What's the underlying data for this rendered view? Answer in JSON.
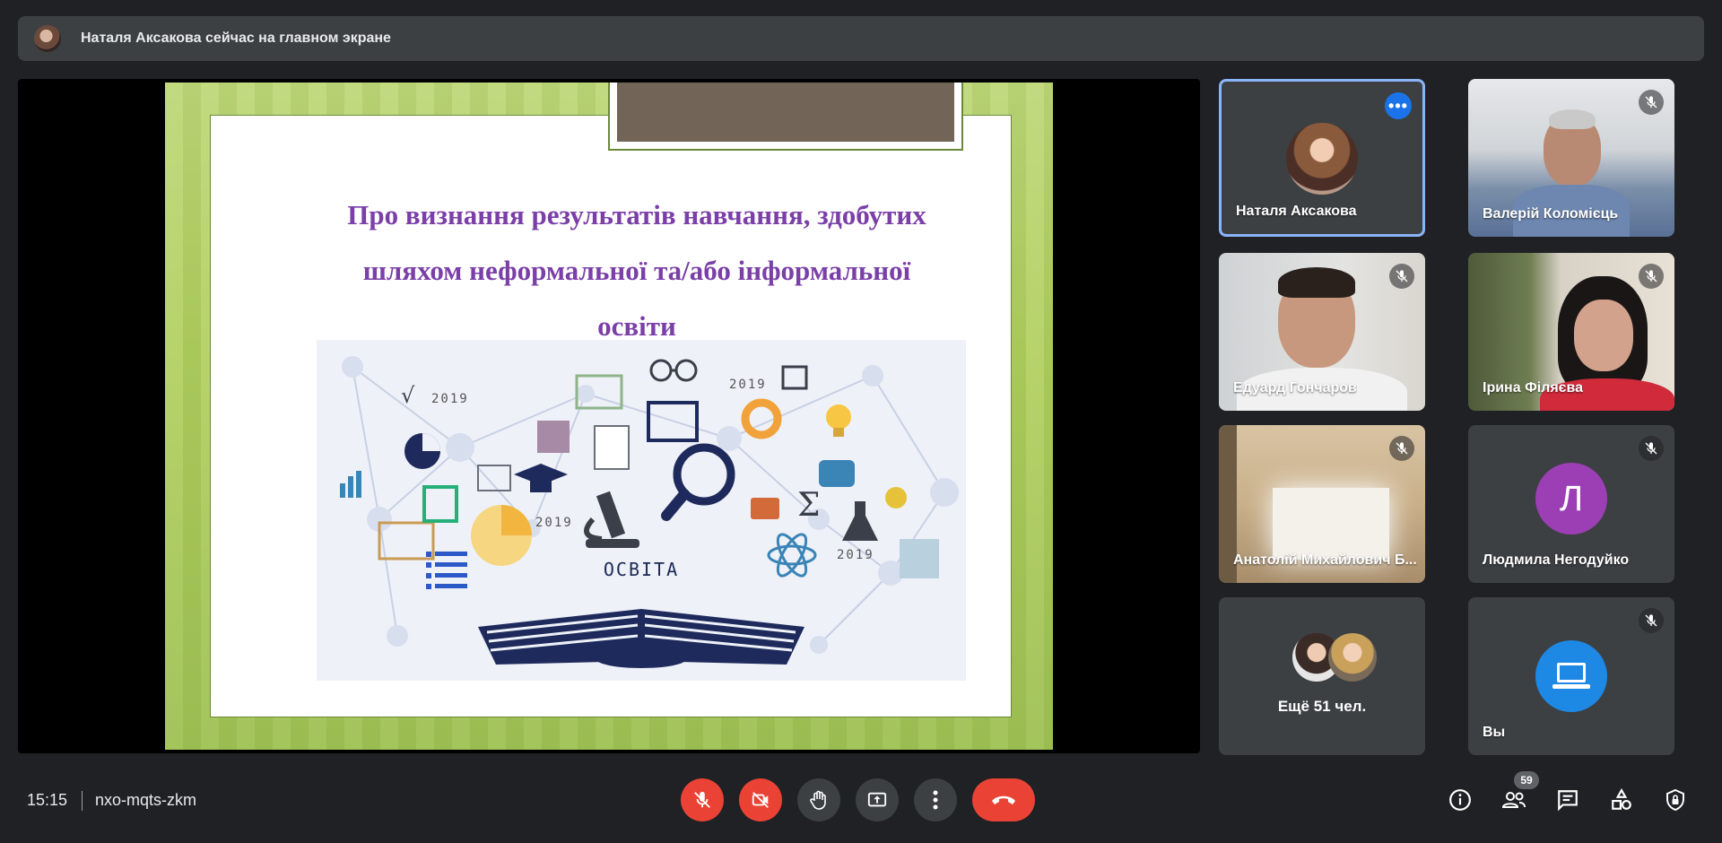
{
  "banner": {
    "text": "Наталя Аксакова сейчас на главном экране"
  },
  "slide": {
    "title_lines": [
      "Про визнання результатів навчання, здобутих",
      "шляхом неформальної та/або інформальної",
      "освіти"
    ],
    "illustration_caption": "ОСВІТА",
    "years": [
      "2019",
      "2019",
      "2019",
      "2019"
    ]
  },
  "participants": [
    {
      "name": "Наталя Аксакова",
      "state": "speaking-presenter"
    },
    {
      "name": "Валерій Коломієць",
      "state": "muted"
    },
    {
      "name": "Едуард Гончаров",
      "state": "muted"
    },
    {
      "name": "Ірина Філяєва",
      "state": "muted"
    },
    {
      "name": "Анатолій Михайлович Б...",
      "state": "muted"
    },
    {
      "name": "Людмила Негодуйко",
      "initial": "Л",
      "state": "muted"
    },
    {
      "name": "Ещё 51 чел."
    },
    {
      "name": "Вы",
      "state": "muted"
    }
  ],
  "bottom": {
    "time": "15:15",
    "meeting_code": "nxo-mqts-zkm",
    "people_count": "59"
  },
  "colors": {
    "background": "#202124",
    "tile": "#3c4043",
    "danger": "#ea4335",
    "accent": "#1a73e8",
    "active_border": "#8ab4f8",
    "slide_title": "#7b3fa8"
  },
  "icons": {
    "mic": "mic-off-icon",
    "camera": "videocam-off-icon",
    "hand": "hand-raise-icon",
    "present": "present-screen-icon",
    "more": "more-vert-icon",
    "end": "call-end-icon",
    "info": "info-icon",
    "people": "people-icon",
    "chat": "chat-icon",
    "activities": "activities-icon",
    "host": "host-controls-icon"
  }
}
